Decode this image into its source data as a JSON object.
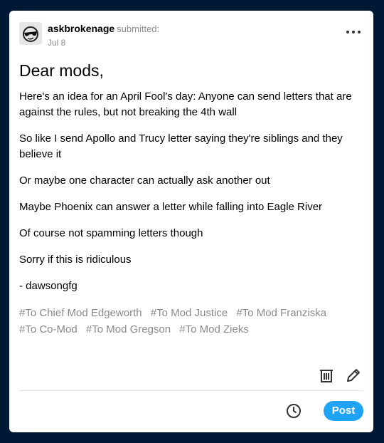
{
  "post": {
    "username": "askbrokenage",
    "submitted_label": "submitted:",
    "date": "Jul 8",
    "title": "Dear mods,",
    "paragraphs": [
      "Here's an idea for an April Fool's day: Anyone can send letters that are against the rules, but not breaking the 4th wall",
      "So like I send Apollo and Trucy letter saying they're siblings and they believe it",
      "Or maybe one character can actually ask another out",
      "Maybe Phoenix can answer a letter while falling into Eagle River",
      "Of course not spamming letters though",
      "Sorry if this is ridiculous",
      "- dawsongfg"
    ],
    "tags": [
      "#To Chief Mod Edgeworth",
      "#To Mod Justice",
      "#To Mod Franziska",
      "#To Co-Mod",
      "#To Mod Gregson",
      "#To Mod Zieks"
    ]
  },
  "actions": {
    "post_label": "Post"
  },
  "icons": {
    "avatar": "sunglasses-avatar-icon",
    "more": "more-horizontal-icon",
    "delete": "trash-icon",
    "edit": "pencil-icon",
    "schedule": "clock-icon"
  },
  "colors": {
    "background": "#001935",
    "card": "#ffffff",
    "accent": "#1fa3f5",
    "muted_text": "#8a8a8a"
  }
}
